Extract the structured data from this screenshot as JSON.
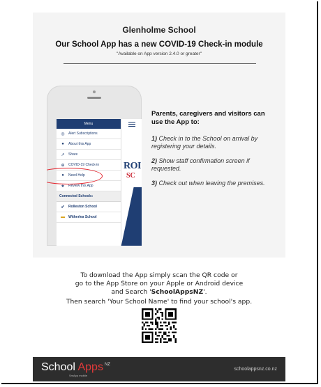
{
  "school_name": "Glenholme School",
  "headline": "Our School App has a new COVID-19 Check-in module",
  "version_note": "\"Available on App version 2.4.0 or greater\"",
  "phone_screen": {
    "menu_title": "Menu",
    "items": [
      {
        "label": "Alert Subscriptions",
        "icon": "check-circle-icon"
      },
      {
        "label": "About this App",
        "icon": "info-icon"
      },
      {
        "label": "Share",
        "icon": "share-icon"
      },
      {
        "label": "COVID-19 Check-in",
        "icon": "checkin-icon"
      },
      {
        "label": "Need Help",
        "icon": "help-icon"
      },
      {
        "label": "Review this App",
        "icon": "star-icon"
      }
    ],
    "connected_label": "Connected Schools:",
    "schools": [
      {
        "label": "Rolleston School",
        "icon": "check-icon"
      },
      {
        "label": "Witherlea School",
        "icon": "flag-icon"
      }
    ],
    "brand_fragment_1": "ROI",
    "brand_fragment_2": "SC"
  },
  "info": {
    "title": "Parents, caregivers and visitors can use the App to:",
    "steps": [
      {
        "num": "1)",
        "text": "Check in to the School on arrival by registering your details."
      },
      {
        "num": "2)",
        "text": "Show staff confirmation screen if requested."
      },
      {
        "num": "3)",
        "text": "Check out when leaving the premises."
      }
    ]
  },
  "download_text_1": "To download the App simply scan the QR code or",
  "download_text_2": "go to the App Store on your Apple or Android device",
  "download_text_3a": "and Search '",
  "download_text_3b": "SchoolAppsNZ",
  "download_text_3c": "'.",
  "search_text": "Then search 'Your School Name' to find your school's app.",
  "footer": {
    "brand_a": "School ",
    "brand_b": "Apps",
    "brand_sup": "NZ",
    "brand_sub": "SmApp mobile",
    "website": "schoolappsnz.co.nz"
  },
  "colors": {
    "navy": "#1f3e73",
    "red": "#e3262f",
    "footer_bg": "#2d2d2d"
  }
}
